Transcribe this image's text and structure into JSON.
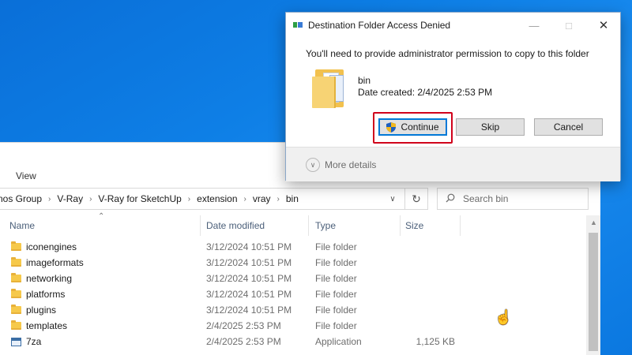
{
  "explorer": {
    "ribbon_tab": "View",
    "breadcrumb": [
      "nos Group",
      "V-Ray",
      "V-Ray for SketchUp",
      "extension",
      "vray",
      "bin"
    ],
    "search_placeholder": "Search bin",
    "columns": {
      "name": "Name",
      "date": "Date modified",
      "type": "Type",
      "size": "Size"
    },
    "rows": [
      {
        "name": "iconengines",
        "date": "3/12/2024 10:51 PM",
        "type": "File folder",
        "size": "",
        "icon": "folder-icon"
      },
      {
        "name": "imageformats",
        "date": "3/12/2024 10:51 PM",
        "type": "File folder",
        "size": "",
        "icon": "folder-icon"
      },
      {
        "name": "networking",
        "date": "3/12/2024 10:51 PM",
        "type": "File folder",
        "size": "",
        "icon": "folder-icon"
      },
      {
        "name": "platforms",
        "date": "3/12/2024 10:51 PM",
        "type": "File folder",
        "size": "",
        "icon": "folder-icon"
      },
      {
        "name": "plugins",
        "date": "3/12/2024 10:51 PM",
        "type": "File folder",
        "size": "",
        "icon": "folder-icon"
      },
      {
        "name": "templates",
        "date": "2/4/2025 2:53 PM",
        "type": "File folder",
        "size": "",
        "icon": "folder-icon"
      },
      {
        "name": "7za",
        "date": "2/4/2025 2:53 PM",
        "type": "Application",
        "size": "1,125 KB",
        "icon": "app-icon"
      }
    ]
  },
  "dialog": {
    "title": "Destination Folder Access Denied",
    "message": "You'll need to provide administrator permission to copy to this folder",
    "file_name": "bin",
    "file_date": "Date created: 2/4/2025 2:53 PM",
    "buttons": {
      "continue": "Continue",
      "skip": "Skip",
      "cancel": "Cancel"
    },
    "more_details": "More details",
    "highlight_color": "#d0021b"
  }
}
